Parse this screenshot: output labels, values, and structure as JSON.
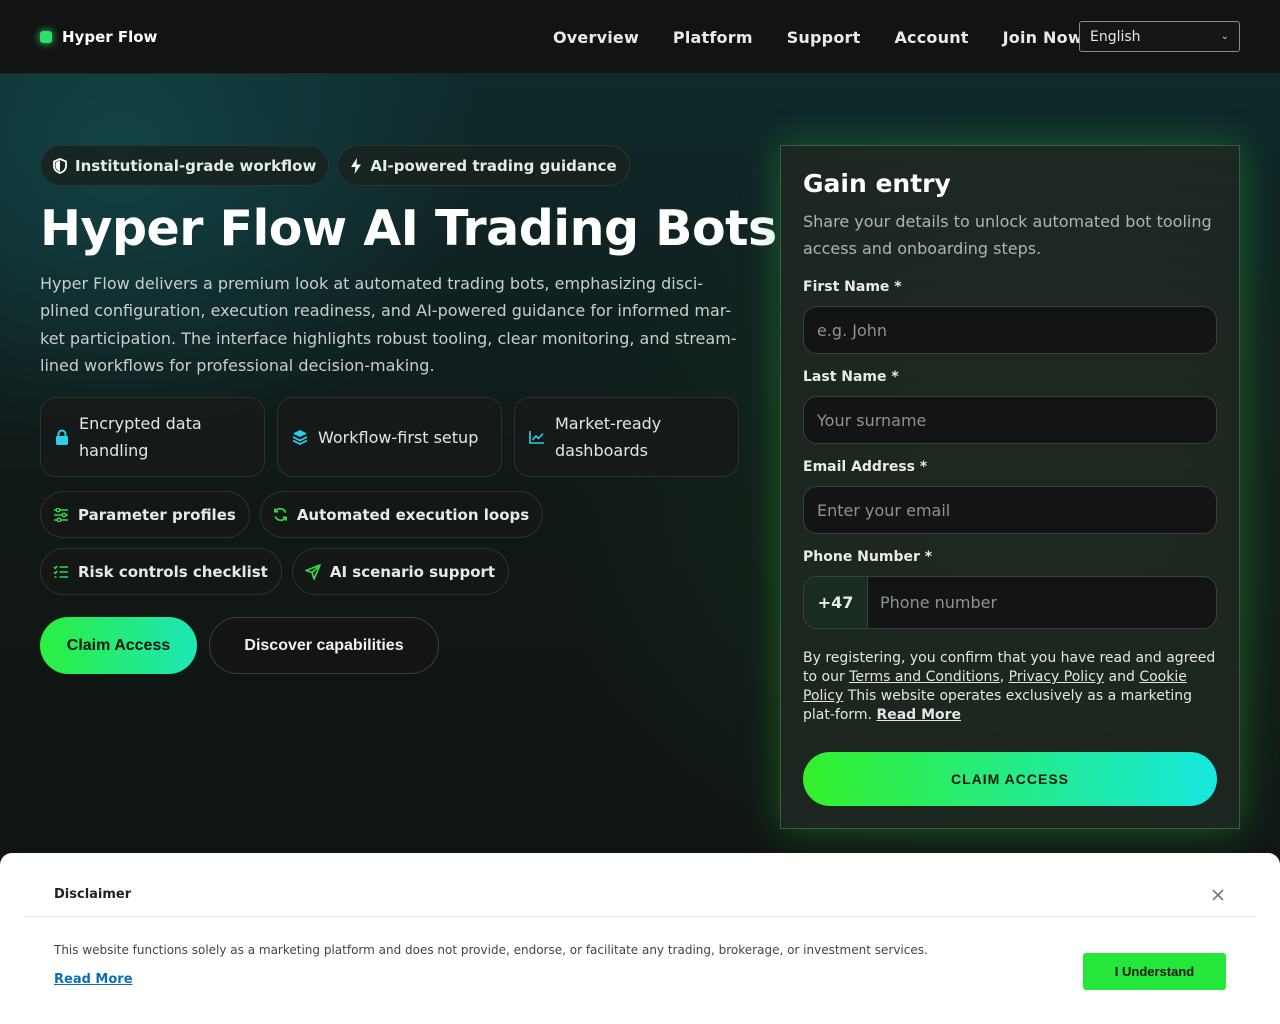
{
  "header": {
    "logo": "Hyper Flow",
    "nav": [
      "Overview",
      "Platform",
      "Support",
      "Account",
      "Join Now"
    ],
    "language": "English"
  },
  "hero": {
    "badges": [
      "Institutional-grade workflow",
      "AI-powered trading guidance"
    ],
    "title": "Hyper Flow AI Trading Bots",
    "lead": "Hyper Flow delivers a premium look at automated trading bots, emphasizing disci-plined configuration, execution readiness, and AI-powered guidance for informed mar-ket participation. The interface highlights robust tooling, clear monitoring, and stream-lined workflows for professional decision-making.",
    "features": [
      "Encrypted data handling",
      "Workflow-first setup",
      "Market-ready dashboards"
    ],
    "chips_row1": [
      "Parameter profiles",
      "Automated execution loops"
    ],
    "chips_row2": [
      "Risk controls checklist",
      "AI scenario support"
    ],
    "cta_primary": "Claim Access",
    "cta_secondary": "Discover capabilities"
  },
  "form": {
    "title": "Gain entry",
    "subtitle": "Share your details to unlock automated bot tooling access and onboarding steps.",
    "first_name_label": "First Name *",
    "first_name_placeholder": "e.g. John",
    "last_name_label": "Last Name *",
    "last_name_placeholder": "Your surname",
    "email_label": "Email Address *",
    "email_placeholder": "Enter your email",
    "phone_label": "Phone Number *",
    "phone_code": "+47",
    "phone_placeholder": "Phone number",
    "legal_prefix": "By registering, you confirm that you have read and agreed to our ",
    "terms": "Terms and Conditions",
    "comma": ", ",
    "privacy": "Privacy Policy",
    "and": " and ",
    "cookie": "Cookie Policy",
    "legal_suffix": " This website operates exclusively as a marketing plat-form. ",
    "read_more": "Read More",
    "submit": "CLAIM ACCESS"
  },
  "disclaimer": {
    "title": "Disclaimer",
    "text": "This website functions solely as a marketing platform and does not provide, endorse, or facilitate any trading, brokerage, or investment services.",
    "read_more": "Read More",
    "button": "I Understand"
  },
  "colors": {
    "accent_green": "#2af03e",
    "accent_cyan": "#1de6b8",
    "icon_green": "#35d64a",
    "icon_cyan": "#2ad0e6"
  }
}
